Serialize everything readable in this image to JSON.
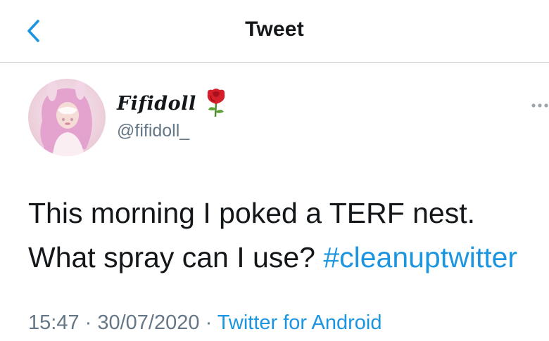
{
  "header": {
    "title": "Tweet",
    "back_icon": "chevron-left-icon"
  },
  "author": {
    "display_name": "Fifidoll",
    "name_emoji": "rose-icon",
    "handle": "@fifidoll_",
    "avatar": "avatar-image"
  },
  "tweet": {
    "line1": "This morning I poked a TERF nest.",
    "line2_text": "What spray can I use? ",
    "hashtag": "#cleanuptwitter"
  },
  "meta": {
    "time": "15:47",
    "separator1": " · ",
    "date": "30/07/2020",
    "separator2": " · ",
    "source": "Twitter for Android"
  },
  "colors": {
    "link": "#1b95e0",
    "secondary_text": "#657786",
    "divider": "#c9c9c9"
  }
}
